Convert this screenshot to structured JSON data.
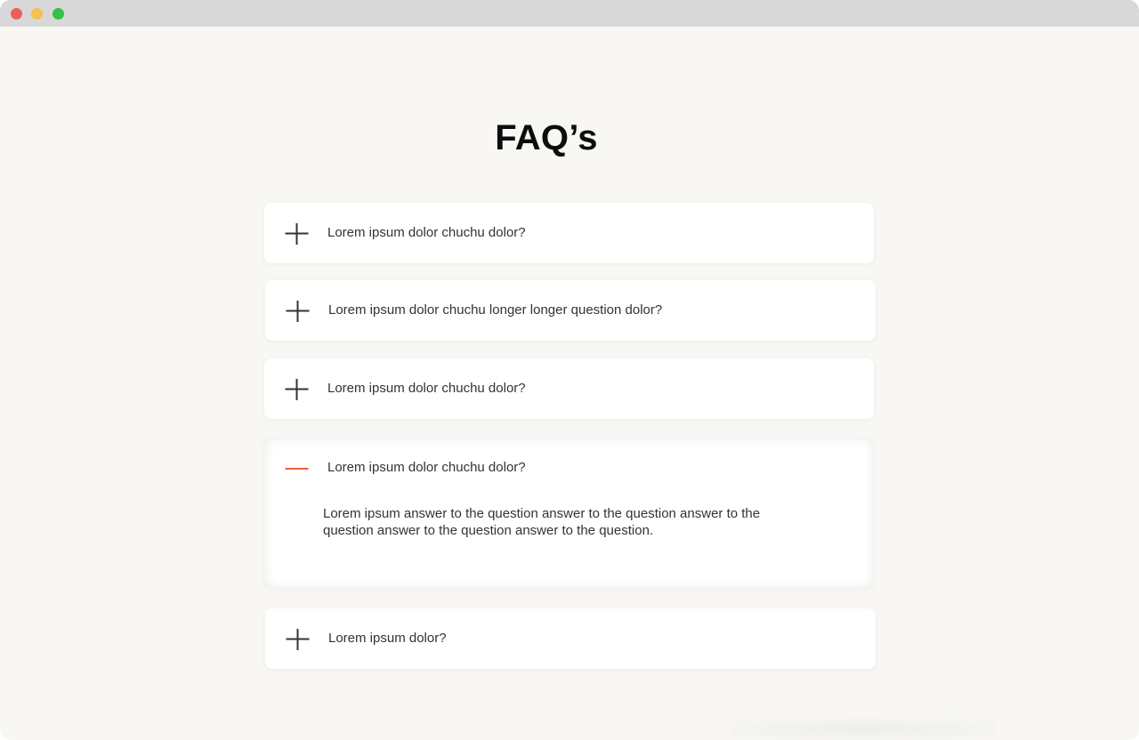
{
  "page": {
    "title": "FAQ’s"
  },
  "faqs": [
    {
      "question": "Lorem ipsum dolor chuchu dolor?",
      "state": "collapsed",
      "icon": "plus-icon"
    },
    {
      "question": "Lorem ipsum dolor chuchu longer longer question dolor?",
      "state": "collapsed",
      "icon": "plus-icon"
    },
    {
      "question": "Lorem ipsum dolor chuchu dolor?",
      "state": "collapsed",
      "icon": "plus-icon"
    },
    {
      "question": "Lorem ipsum dolor chuchu dolor?",
      "state": "expanded",
      "icon": "minus-icon",
      "answer": "Lorem ipsum answer to the question answer to the question answer to the question answer to the question answer to the question."
    },
    {
      "question": "Lorem ipsum dolor?",
      "state": "collapsed",
      "icon": "plus-icon"
    }
  ],
  "colors": {
    "background": "#f8f7f4",
    "card": "#ffffff",
    "icon": "#333333",
    "accent": "#e8603c",
    "titlebar": "#d8d8d8"
  }
}
